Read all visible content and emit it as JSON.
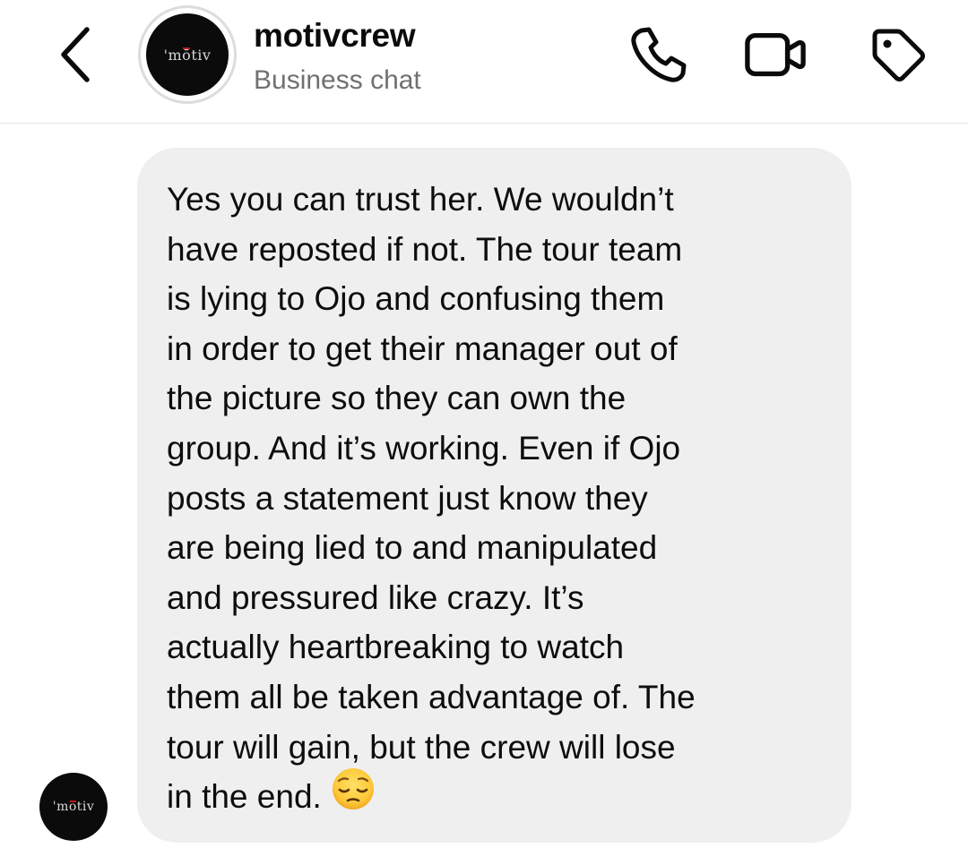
{
  "header": {
    "back_icon": "chevron-left-icon",
    "avatar_logo": {
      "tick": "'",
      "o": "ō",
      "rest": "tiv",
      "m": "m"
    },
    "name": "motivcrew",
    "subtitle": "Business chat",
    "actions": [
      {
        "name": "call",
        "icon": "phone-icon"
      },
      {
        "name": "video",
        "icon": "video-camera-icon"
      },
      {
        "name": "label",
        "icon": "tag-icon"
      }
    ]
  },
  "message": {
    "sender_avatar_logo": {
      "tick": "'",
      "o": "ō",
      "rest": "tiv",
      "m": "m"
    },
    "text": "Yes you can trust her. We wouldn’t\nhave reposted if not. The tour team\nis lying to Ojo and confusing them\nin order to get their manager out of\nthe picture so they can own the\ngroup. And it’s working. Even if Ojo\nposts a statement just know they\nare being lied to and manipulated\nand pressured like crazy. It’s\nactually heartbreaking to watch\nthem all be taken advantage of. The\ntour will gain, but the crew will lose\nin the end.",
    "emoji_icon": "pensive-face-icon"
  },
  "colors": {
    "bubble_bg": "#efeff0",
    "logo_accent": "#c21818",
    "avatar_bg": "#0b0b0b",
    "subtitle": "#707070"
  }
}
